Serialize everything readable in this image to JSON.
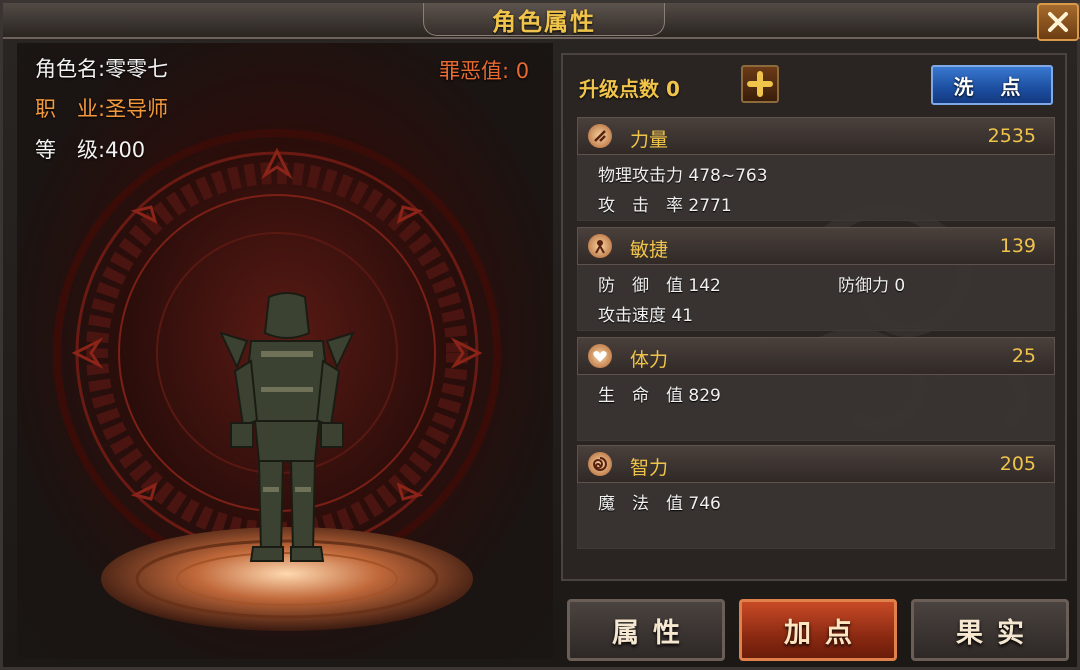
{
  "window": {
    "title": "角色属性",
    "close_icon": "close-icon"
  },
  "character": {
    "name_label": "角色名:",
    "name": "零零七",
    "class_label": "职　业:",
    "class": "圣导师",
    "level_label": "等　级:",
    "level": "400",
    "evil_label": "罪恶值:",
    "evil": "0"
  },
  "points": {
    "label": "升级点数",
    "value": "0",
    "plus_icon": "plus-icon",
    "wash_button": "洗 点"
  },
  "stats": [
    {
      "name": "力量",
      "value": "2535",
      "icon": "strength-icon",
      "lines": [
        {
          "label": "物理攻击力",
          "value": "478~763"
        },
        {
          "label": "攻　击　率",
          "value": "2771"
        }
      ]
    },
    {
      "name": "敏捷",
      "value": "139",
      "icon": "agility-icon",
      "lines": [
        {
          "label": "防　御　值",
          "value": "142"
        },
        {
          "label": "防御力",
          "value": "0"
        },
        {
          "label": "攻击速度",
          "value": "41"
        }
      ]
    },
    {
      "name": "体力",
      "value": "25",
      "icon": "heart-icon",
      "lines": [
        {
          "label": "生　命　值",
          "value": "829"
        }
      ]
    },
    {
      "name": "智力",
      "value": "205",
      "icon": "spiral-icon",
      "lines": [
        {
          "label": "魔　法　值",
          "value": "746"
        }
      ]
    }
  ],
  "tabs": [
    {
      "label": "属性",
      "active": false
    },
    {
      "label": "加点",
      "active": true
    },
    {
      "label": "果实",
      "active": false
    }
  ],
  "colors": {
    "gold": "#f0c44a",
    "orange": "#f59a3c",
    "evil": "#e86a30",
    "wash_blue": "#1c4ea0",
    "active_tab": "#8c2a12"
  }
}
